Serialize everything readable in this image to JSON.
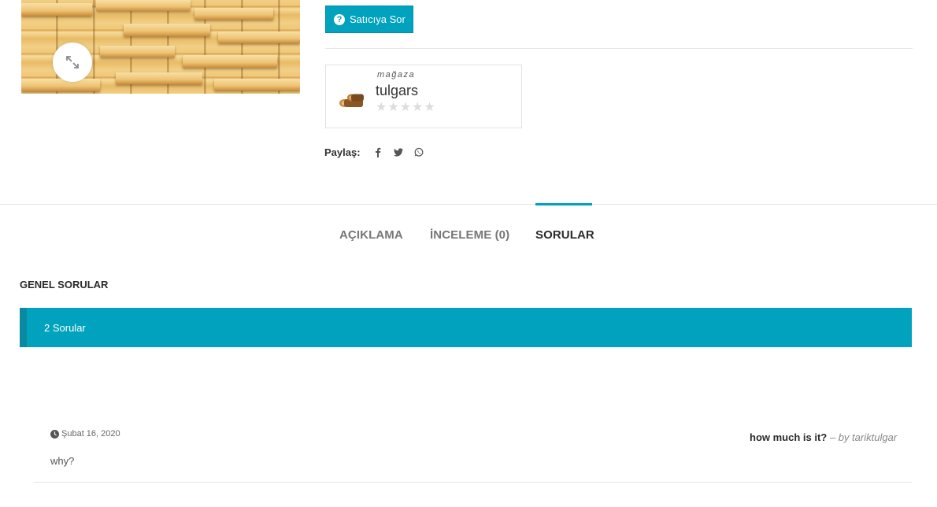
{
  "product": {
    "image_alt": "wood planks",
    "zoom_icon": "expand-icon"
  },
  "ask_seller": {
    "label": "Satıcıya Sor",
    "icon": "question-circle-icon"
  },
  "store": {
    "label": "mağaza",
    "name": "tulgars",
    "rating": 0,
    "rating_max": 5,
    "logo_icon": "firewood-logo"
  },
  "share": {
    "label": "Paylaş:",
    "icons": [
      "facebook-icon",
      "twitter-icon",
      "whatsapp-icon"
    ]
  },
  "tabs": [
    {
      "label": "AÇIKLAMA",
      "active": false
    },
    {
      "label": "İNCELEME (0)",
      "active": false
    },
    {
      "label": "SORULAR",
      "active": true
    }
  ],
  "questions": {
    "section_title": "GENEL SORULAR",
    "count_label": "2 Sorular",
    "items": [
      {
        "date": "Şubat 16, 2020",
        "question": "how much is it?",
        "author": "– by tariktulgar",
        "answer": "why?"
      }
    ]
  },
  "colors": {
    "accent": "#00a2bd",
    "accent_dark": "#0a8aa0",
    "text": "#333333",
    "muted": "#777777"
  }
}
